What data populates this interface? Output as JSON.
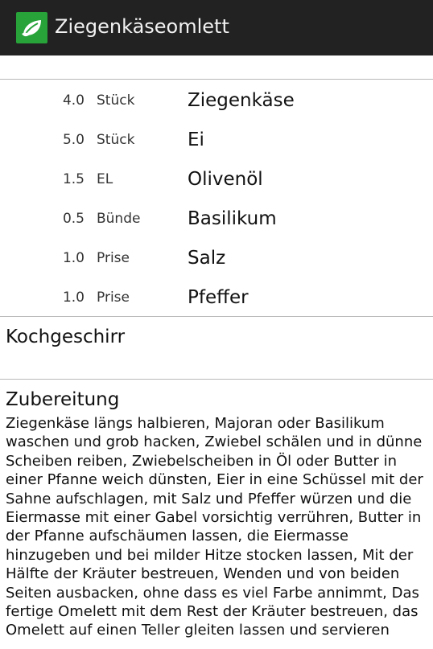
{
  "actionbar": {
    "title": "Ziegenkäseomlett",
    "icon": "leaf-icon",
    "icon_bg": "#27a33a"
  },
  "ingredients": [
    {
      "amount": "4.0",
      "unit": "Stück",
      "name": "Ziegenkäse"
    },
    {
      "amount": "5.0",
      "unit": "Stück",
      "name": "Ei"
    },
    {
      "amount": "1.5",
      "unit": "EL",
      "name": "Olivenöl"
    },
    {
      "amount": "0.5",
      "unit": "Bünde",
      "name": "Basilikum"
    },
    {
      "amount": "1.0",
      "unit": "Prise",
      "name": "Salz"
    },
    {
      "amount": "1.0",
      "unit": "Prise",
      "name": "Pfeffer"
    }
  ],
  "cookware": {
    "title": "Kochgeschirr"
  },
  "preparation": {
    "title": "Zubereitung",
    "text": "Ziegenkäse längs halbieren, Majoran oder Basilikum waschen und grob hacken, Zwiebel schälen und in dünne Scheiben reiben, Zwiebelscheiben in Öl oder Butter in einer Pfanne weich dünsten, Eier in eine Schüssel mit der Sahne aufschlagen, mit Salz und Pfeffer würzen und die Eiermasse mit einer Gabel vorsichtig verrühren, Butter in der Pfanne aufschäumen lassen, die Eiermasse hinzugeben und bei milder Hitze stocken lassen, Mit der Hälfte der Kräuter bestreuen, Wenden und von beiden Seiten ausbacken, ohne dass es viel Farbe annimmt, Das fertige Omelett mit dem Rest der Kräuter bestreuen, das Omelett auf einen Teller gleiten lassen und servieren"
  }
}
